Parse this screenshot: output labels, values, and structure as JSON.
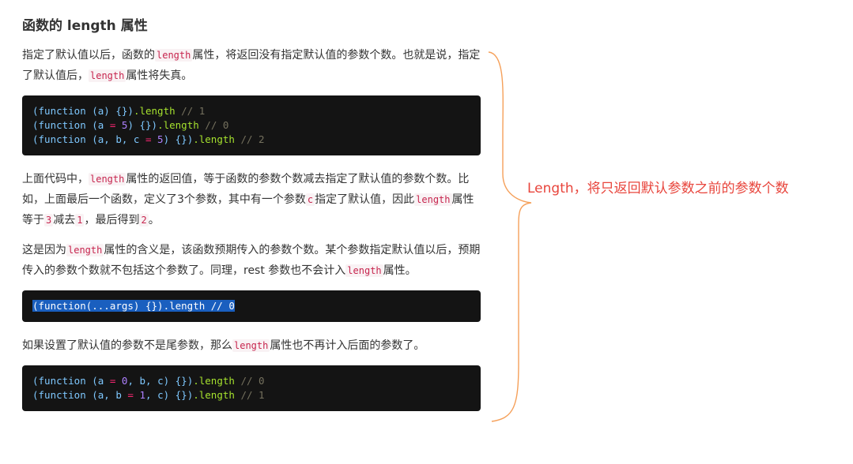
{
  "heading": "函数的 length 属性",
  "para1": {
    "t1": "指定了默认值以后，函数的",
    "c1": "length",
    "t2": "属性，将返回没有指定默认值的参数个数。也就是说，指定了默认值后，",
    "c2": "length",
    "t3": "属性将失真。"
  },
  "code1": {
    "line1": {
      "a": "(function (a) {})",
      "b": ".length",
      "c": " // 1"
    },
    "line2": {
      "a": "(function (a ",
      "op": "=",
      "n": " 5",
      "b": ") {})",
      "p": ".length",
      "c": " // 0"
    },
    "line3": {
      "a": "(function (a, b, c ",
      "op": "=",
      "n": " 5",
      "b": ") {})",
      "p": ".length",
      "c": " // 2"
    }
  },
  "para2": {
    "t1": "上面代码中，",
    "c1": "length",
    "t2": "属性的返回值，等于函数的参数个数减去指定了默认值的参数个数。比如，上面最后一个函数，定义了3个参数，其中有一个参数",
    "c2": "c",
    "t3": "指定了默认值，因此",
    "c3": "length",
    "t4": "属性等于",
    "c4": "3",
    "t5": "减去",
    "c5": "1",
    "t6": "，最后得到",
    "c6": "2",
    "t7": "。"
  },
  "para3": {
    "t1": "这是因为",
    "c1": "length",
    "t2": "属性的含义是，该函数预期传入的参数个数。某个参数指定默认值以后，预期传入的参数个数就不包括这个参数了。同理，rest 参数也不会计入",
    "c2": "length",
    "t3": "属性。"
  },
  "code2": {
    "line1": "(function(...args) {}).length // 0"
  },
  "para4": {
    "t1": "如果设置了默认值的参数不是尾参数，那么",
    "c1": "length",
    "t2": "属性也不再计入后面的参数了。"
  },
  "code3": {
    "line1": {
      "a": "(function (a ",
      "op": "=",
      "n": " 0",
      "b": ", b, c) {})",
      "p": ".length",
      "c": " // 0"
    },
    "line2": {
      "a": "(function (a, b ",
      "op": "=",
      "n": " 1",
      "b": ", c) {})",
      "p": ".length",
      "c": " // 1"
    }
  },
  "annotation": {
    "text": "Length，将只返回默认参数之前的参数个数",
    "color": "#e8453c",
    "brace_color": "#f5a05a"
  }
}
